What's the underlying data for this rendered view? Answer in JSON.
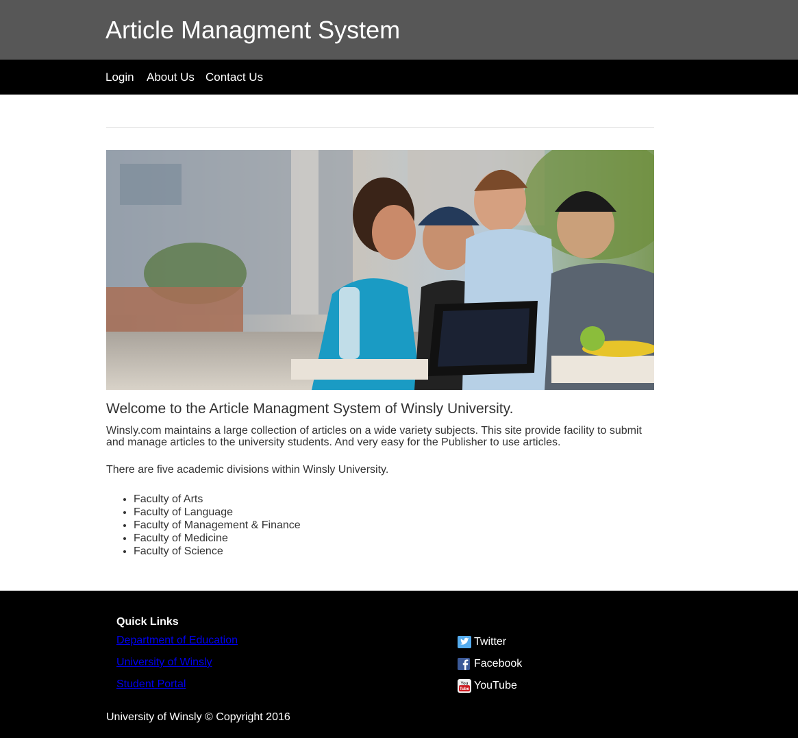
{
  "header": {
    "title": "Article Managment System",
    "bg_color": "#575757"
  },
  "nav": {
    "items": [
      "Login",
      "About Us",
      "Contact Us"
    ],
    "bg_color": "#000000"
  },
  "main": {
    "hero_image_icon": "students-laptop-photo",
    "welcome": "Welcome to the Article Managment System of Winsly University.",
    "intro": "Winsly.com maintains a large collection of articles on a wide variety subjects. This site provide facility to submit and manage articles to the university students. And very easy for the Publisher to use articles.",
    "divisions_intro": "There are five academic divisions within Winsly University.",
    "faculties": [
      "Faculty of Arts",
      "Faculty of Language",
      "Faculty of Management & Finance",
      "Faculty of Medicine",
      "Faculty of Science"
    ]
  },
  "footer": {
    "quick_links_title": "Quick Links",
    "quick_links": [
      "Department of Education",
      "University of Winsly",
      "Student Portal"
    ],
    "social": [
      {
        "label": "Twitter",
        "icon": "twitter-icon",
        "color": "#55acee"
      },
      {
        "label": "Facebook",
        "icon": "facebook-icon",
        "color": "#3b5998"
      },
      {
        "label": "YouTube",
        "icon": "youtube-icon",
        "color": "#cc181e"
      }
    ],
    "copyright": "University of Winsly © Copyright 2016",
    "link_color": "#0000ee"
  }
}
